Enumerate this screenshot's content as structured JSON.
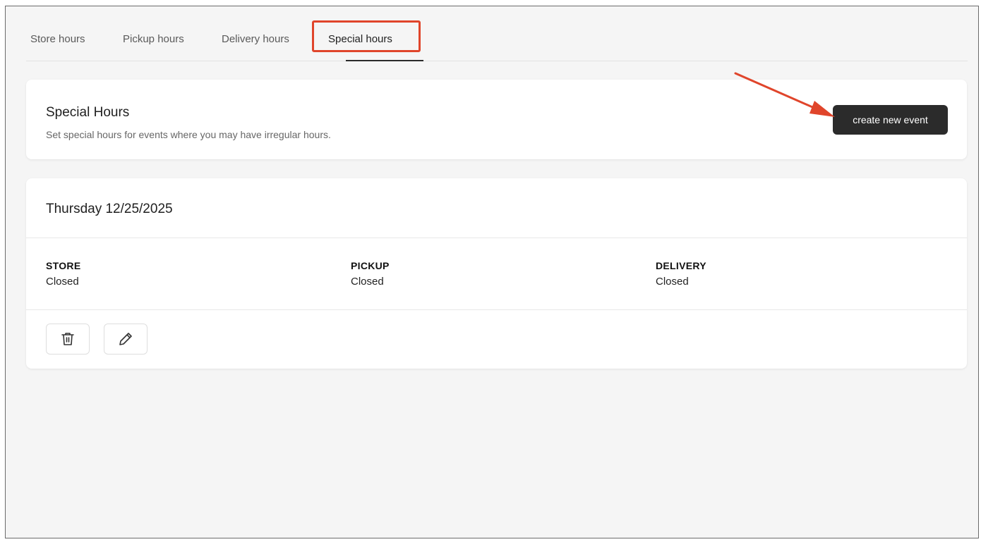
{
  "tabs": [
    {
      "label": "Store hours",
      "active": false
    },
    {
      "label": "Pickup hours",
      "active": false
    },
    {
      "label": "Delivery hours",
      "active": false
    },
    {
      "label": "Special hours",
      "active": true
    }
  ],
  "header": {
    "title": "Special Hours",
    "description": "Set special hours for events where you may have irregular hours.",
    "create_button_label": "create new event"
  },
  "event": {
    "date": "Thursday 12/25/2025",
    "columns": [
      {
        "label": "STORE",
        "value": "Closed"
      },
      {
        "label": "PICKUP",
        "value": "Closed"
      },
      {
        "label": "DELIVERY",
        "value": "Closed"
      }
    ],
    "actions": [
      {
        "icon": "trash-icon"
      },
      {
        "icon": "pencil-icon"
      }
    ]
  },
  "colors": {
    "annotation": "#e0452b",
    "primary_button": "#2b2b2b",
    "background": "#f5f5f5"
  }
}
